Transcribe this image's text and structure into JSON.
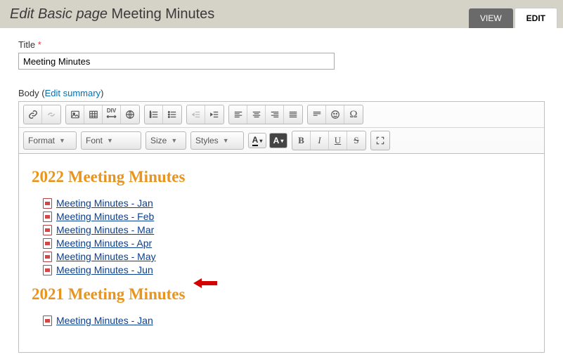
{
  "header": {
    "prefix": "Edit Basic page",
    "title": "Meeting Minutes",
    "tabs": {
      "view": "VIEW",
      "edit": "EDIT"
    }
  },
  "title_field": {
    "label": "Title",
    "required_marker": "*",
    "value": "Meeting Minutes"
  },
  "body_field": {
    "label": "Body",
    "edit_summary": "Edit summary"
  },
  "toolbar": {
    "dropdowns": {
      "format": "Format",
      "font": "Font",
      "size": "Size",
      "styles": "Styles"
    },
    "text_color": "A",
    "bg_color": "A",
    "bold": "B",
    "italic": "I",
    "underline": "U",
    "strike": "S"
  },
  "document": {
    "sections": [
      {
        "heading": "2022 Meeting Minutes",
        "items": [
          "Meeting Minutes - Jan",
          "Meeting Minutes - Feb",
          "Meeting Minutes - Mar",
          "Meeting Minutes - Apr",
          "Meeting Minutes - May",
          "Meeting Minutes - Jun"
        ]
      },
      {
        "heading": "2021 Meeting Minutes",
        "items": [
          "Meeting Minutes - Jan"
        ]
      }
    ]
  }
}
